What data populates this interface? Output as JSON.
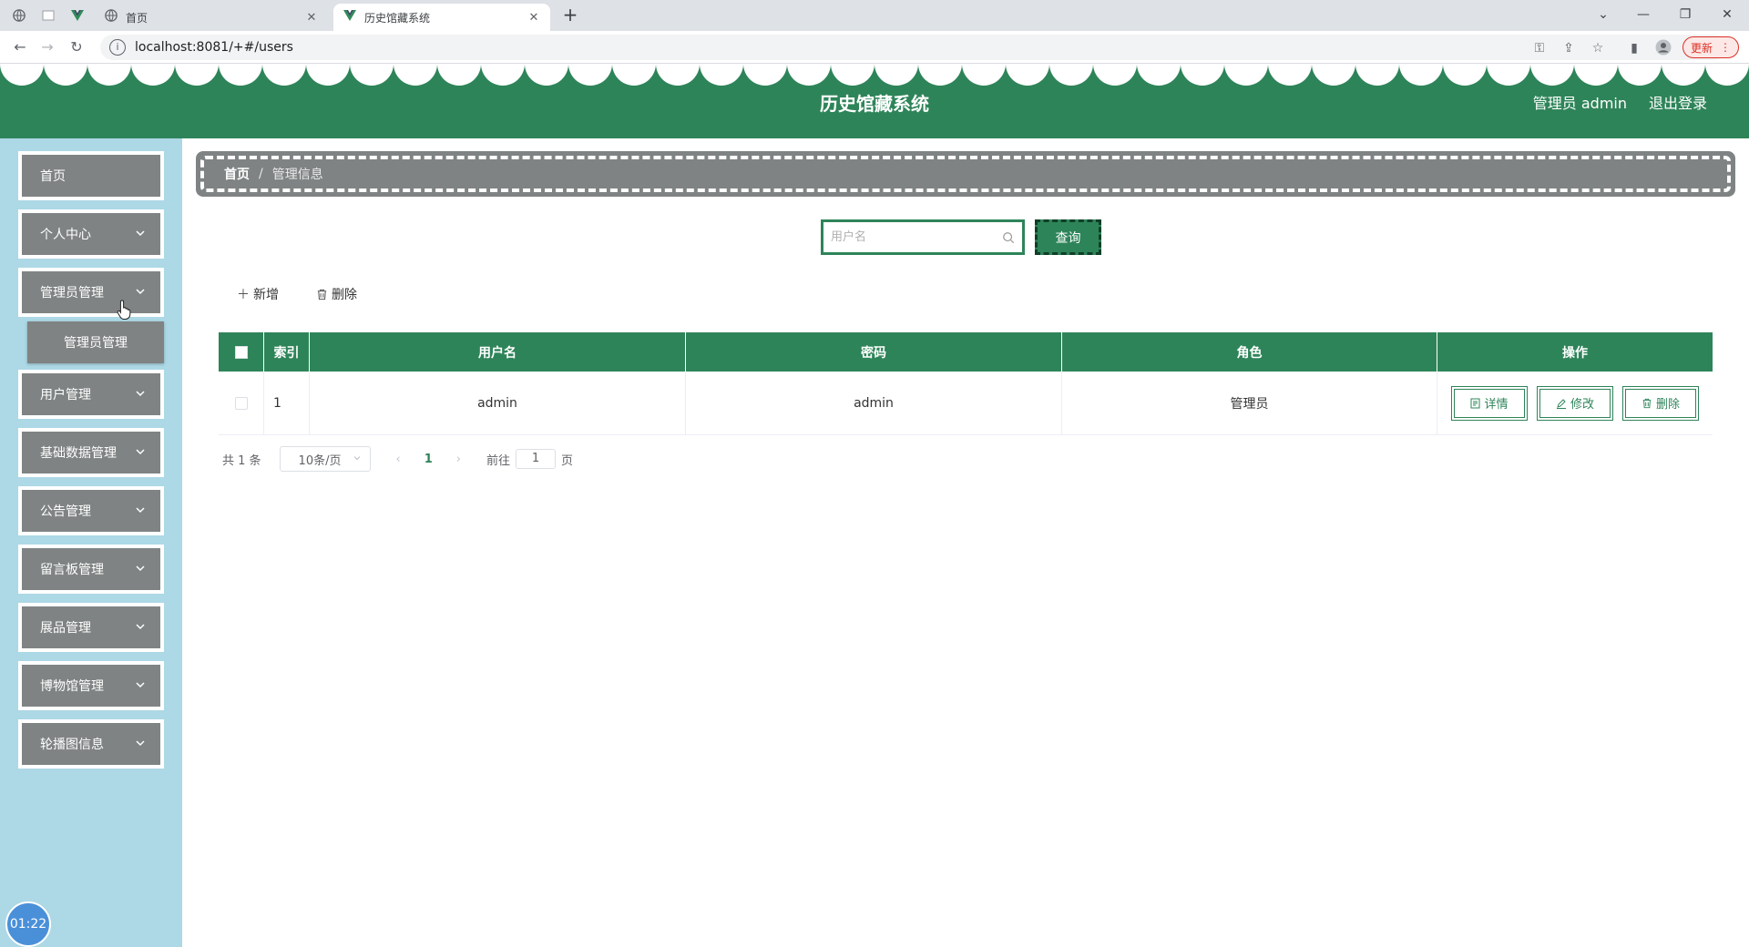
{
  "browser": {
    "tabs": [
      {
        "title": "首页",
        "icon": "globe-icon",
        "active": false
      },
      {
        "title": "历史馆藏系统",
        "icon": "vue-logo-icon",
        "active": true
      }
    ],
    "url": "localhost:8081/+#/users",
    "update_label": "更新"
  },
  "header": {
    "title": "历史馆藏系统",
    "user": "管理员 admin",
    "logout": "退出登录",
    "color": "#2e8459"
  },
  "sidebar": {
    "items": [
      {
        "label": "首页",
        "has_children": false
      },
      {
        "label": "个人中心",
        "has_children": true
      },
      {
        "label": "管理员管理",
        "has_children": true
      },
      {
        "label": "用户管理",
        "has_children": true
      },
      {
        "label": "基础数据管理",
        "has_children": true
      },
      {
        "label": "公告管理",
        "has_children": true
      },
      {
        "label": "留言板管理",
        "has_children": true
      },
      {
        "label": "展品管理",
        "has_children": true
      },
      {
        "label": "博物馆管理",
        "has_children": true
      },
      {
        "label": "轮播图信息",
        "has_children": true
      }
    ],
    "submenu_label": "管理员管理",
    "timer": "01:22"
  },
  "breadcrumb": {
    "home": "首页",
    "separator": "/",
    "current": "管理信息"
  },
  "search": {
    "placeholder": "用户名",
    "button": "查询"
  },
  "actions": {
    "add": "新增",
    "delete": "删除"
  },
  "table": {
    "columns": [
      "索引",
      "用户名",
      "密码",
      "角色",
      "操作"
    ],
    "rows": [
      {
        "index": "1",
        "username": "admin",
        "password": "admin",
        "role": "管理员"
      }
    ],
    "row_actions": {
      "detail": "详情",
      "edit": "修改",
      "delete": "删除"
    }
  },
  "pagination": {
    "total": "共 1 条",
    "page_size": "10条/页",
    "current_page": "1",
    "goto_label": "前往",
    "goto_value": "1",
    "goto_suffix": "页"
  }
}
